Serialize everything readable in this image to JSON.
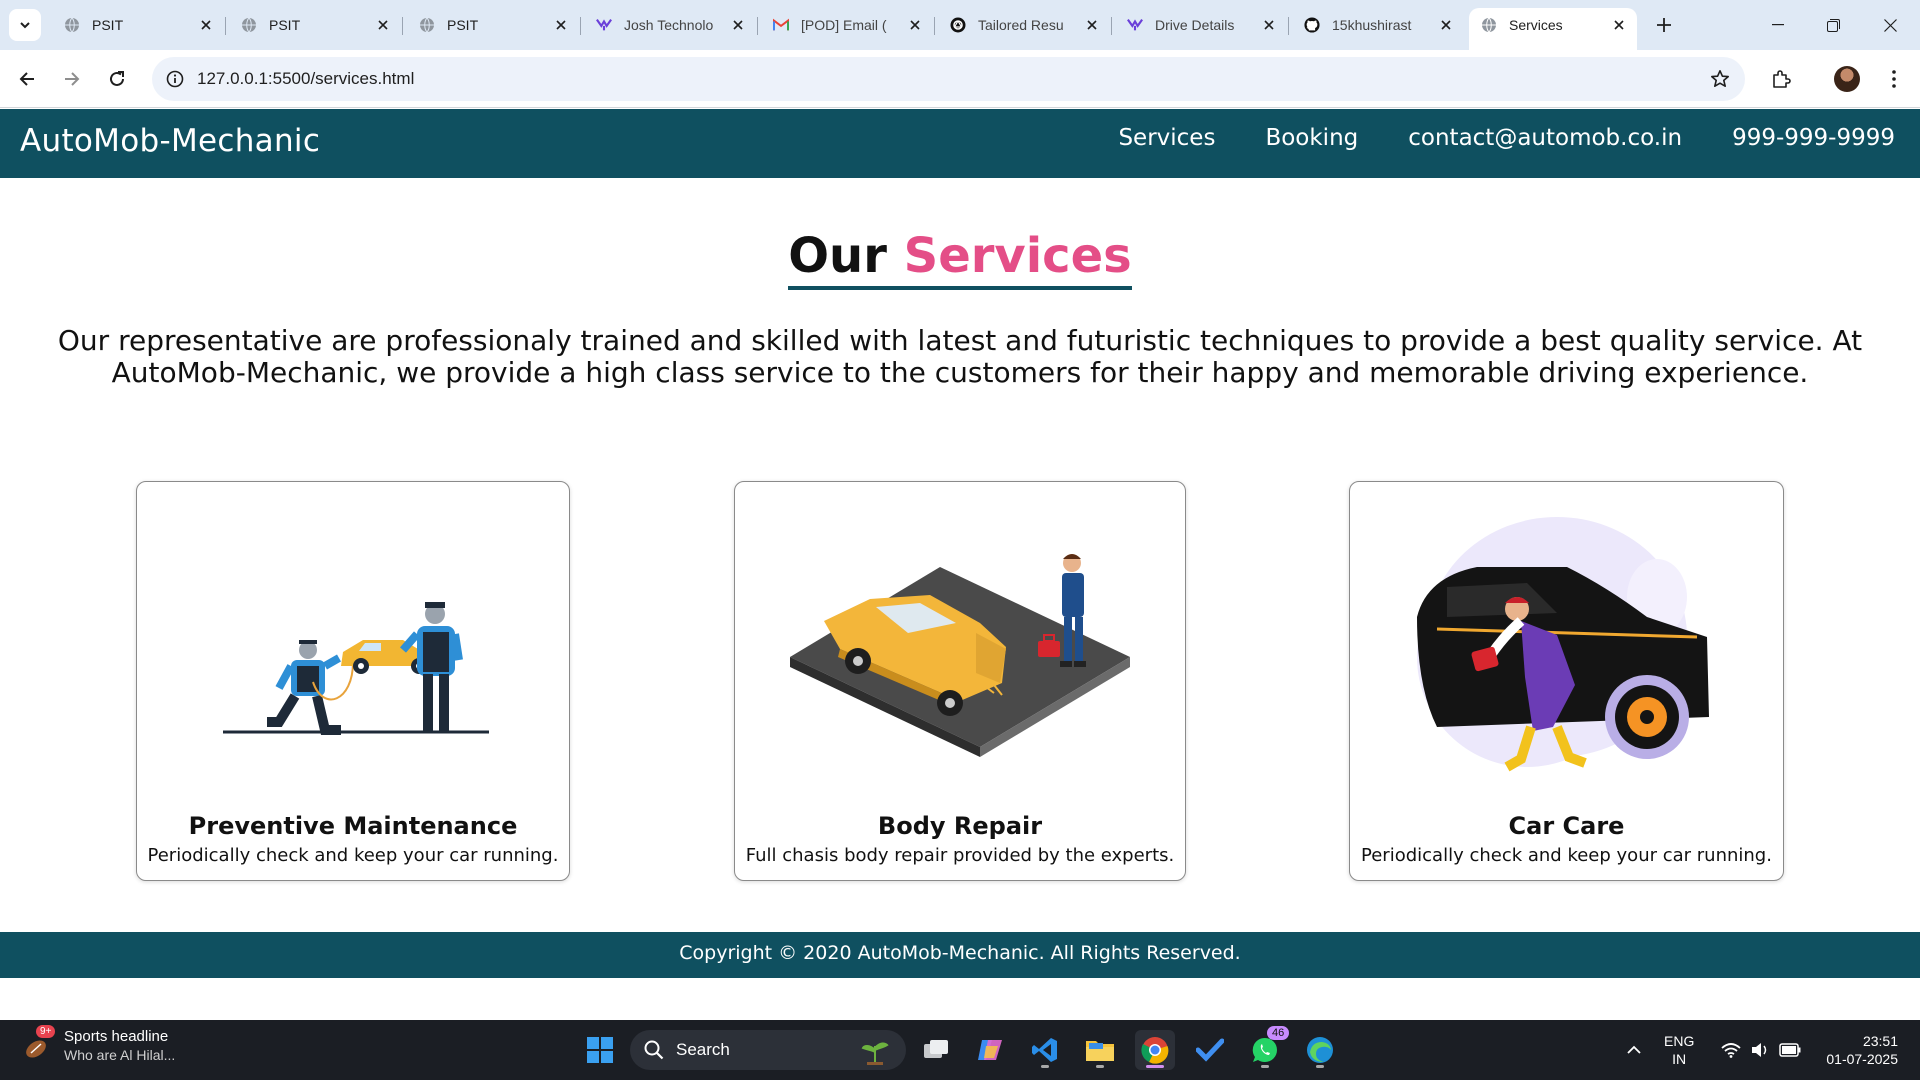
{
  "browser": {
    "tabs": [
      {
        "label": "PSIT",
        "favicon": "globe-icon"
      },
      {
        "label": "PSIT",
        "favicon": "globe-icon"
      },
      {
        "label": "PSIT",
        "favicon": "globe-icon"
      },
      {
        "label": "Josh Technolo",
        "favicon": "josh-logo-icon"
      },
      {
        "label": "[POD] Email (",
        "favicon": "gmail-icon"
      },
      {
        "label": "Tailored Resu",
        "favicon": "openai-icon"
      },
      {
        "label": "Drive Details",
        "favicon": "josh-logo-icon"
      },
      {
        "label": "15khushirast",
        "favicon": "github-icon"
      },
      {
        "label": "Services",
        "favicon": "globe-icon",
        "active": true
      }
    ],
    "url": "127.0.0.1:5500/services.html"
  },
  "site": {
    "brand": "AutoMob-Mechanic",
    "nav": [
      "Services",
      "Booking",
      "contact@automob.co.in",
      "999-999-9999"
    ],
    "heading_prefix": "Our",
    "heading_accent": "Services",
    "intro": "Our representative are professionaly trained and skilled with latest and futuristic techniques to provide a best quality service. At AutoMob-Mechanic, we provide a high class service to the customers for their happy and memorable driving experience.",
    "cards": [
      {
        "title": "Preventive Maintenance",
        "desc": "Periodically check and keep your car running."
      },
      {
        "title": "Body Repair",
        "desc": "Full chasis body repair provided by the experts."
      },
      {
        "title": "Car Care",
        "desc": "Periodically check and keep your car running."
      }
    ],
    "footer": "Copyright © 2020 AutoMob-Mechanic. All Rights Reserved.",
    "colors": {
      "header": "#0f5060",
      "accent": "#e44e87"
    }
  },
  "taskbar": {
    "news_badge": "9+",
    "news_title": "Sports headline",
    "news_sub": "Who are Al Hilal...",
    "search_placeholder": "Search",
    "whatsapp_badge": "46",
    "lang_1": "ENG",
    "lang_2": "IN",
    "time": "23:51",
    "date": "01-07-2025"
  }
}
